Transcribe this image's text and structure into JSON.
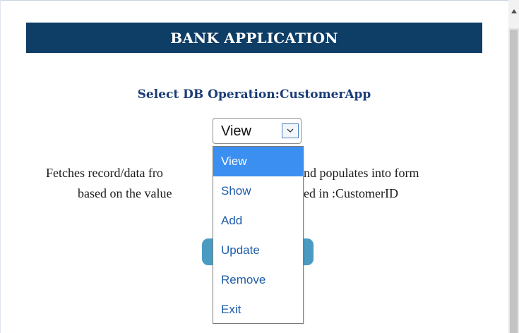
{
  "app": {
    "header_title": "BANK APPLICATION"
  },
  "operation": {
    "title": "Select DB Operation:CustomerApp",
    "selected_value": "View",
    "options": [
      "View",
      "Show",
      "Add",
      "Update",
      "Remove",
      "Exit"
    ],
    "highlighted_option": "View"
  },
  "description": {
    "line1": "Fetches record/data fro",
    "line1_right": "nd populates into form",
    "line2": "based on the value",
    "line2_right": "ed in :CustomerID"
  },
  "colors": {
    "header_bg": "#0e3d66",
    "title_text": "#1b3d78",
    "button_bg": "#4a9bc2",
    "option_highlight": "#3b8ff0",
    "option_text": "#1e5ca8"
  },
  "icons": {
    "select_arrow": "chevron-down-icon",
    "scroll_up": "triangle-up-icon"
  }
}
